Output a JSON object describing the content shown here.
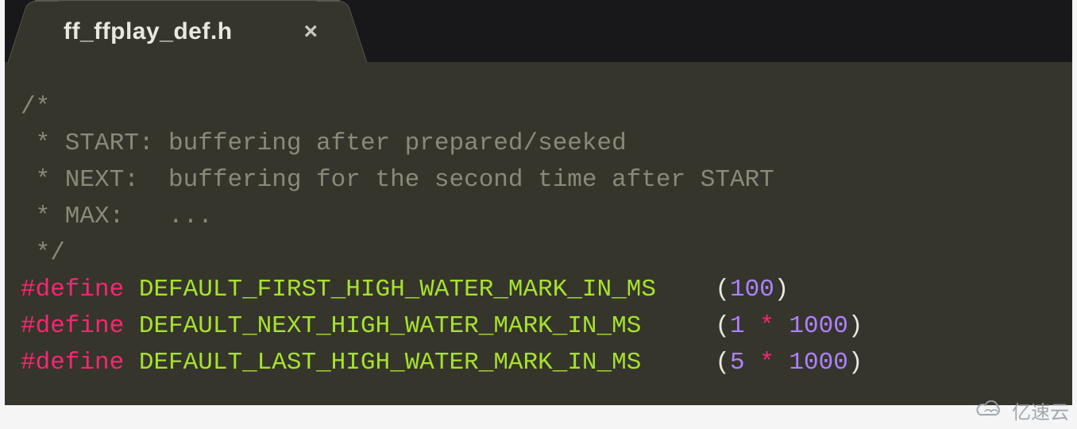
{
  "tab": {
    "filename": "ff_ffplay_def.h",
    "close_glyph": "×"
  },
  "code": {
    "comment": [
      "/*",
      " * START: buffering after prepared/seeked",
      " * NEXT:  buffering for the second time after START",
      " * MAX:   ...",
      " */"
    ],
    "defines": [
      {
        "directive": "#define",
        "name": "DEFAULT_FIRST_HIGH_WATER_MARK_IN_MS",
        "pad": "    ",
        "expr": {
          "parts": [
            {
              "t": "paren",
              "v": "("
            },
            {
              "t": "number",
              "v": "100"
            },
            {
              "t": "paren",
              "v": ")"
            }
          ]
        }
      },
      {
        "directive": "#define",
        "name": "DEFAULT_NEXT_HIGH_WATER_MARK_IN_MS",
        "pad": "     ",
        "expr": {
          "parts": [
            {
              "t": "paren",
              "v": "("
            },
            {
              "t": "number",
              "v": "1"
            },
            {
              "t": "plain",
              "v": " "
            },
            {
              "t": "op",
              "v": "*"
            },
            {
              "t": "plain",
              "v": " "
            },
            {
              "t": "number",
              "v": "1000"
            },
            {
              "t": "paren",
              "v": ")"
            }
          ]
        }
      },
      {
        "directive": "#define",
        "name": "DEFAULT_LAST_HIGH_WATER_MARK_IN_MS",
        "pad": "     ",
        "expr": {
          "parts": [
            {
              "t": "paren",
              "v": "("
            },
            {
              "t": "number",
              "v": "5"
            },
            {
              "t": "plain",
              "v": " "
            },
            {
              "t": "op",
              "v": "*"
            },
            {
              "t": "plain",
              "v": " "
            },
            {
              "t": "number",
              "v": "1000"
            },
            {
              "t": "paren",
              "v": ")"
            }
          ]
        }
      }
    ]
  },
  "watermark": {
    "text": "亿速云"
  }
}
